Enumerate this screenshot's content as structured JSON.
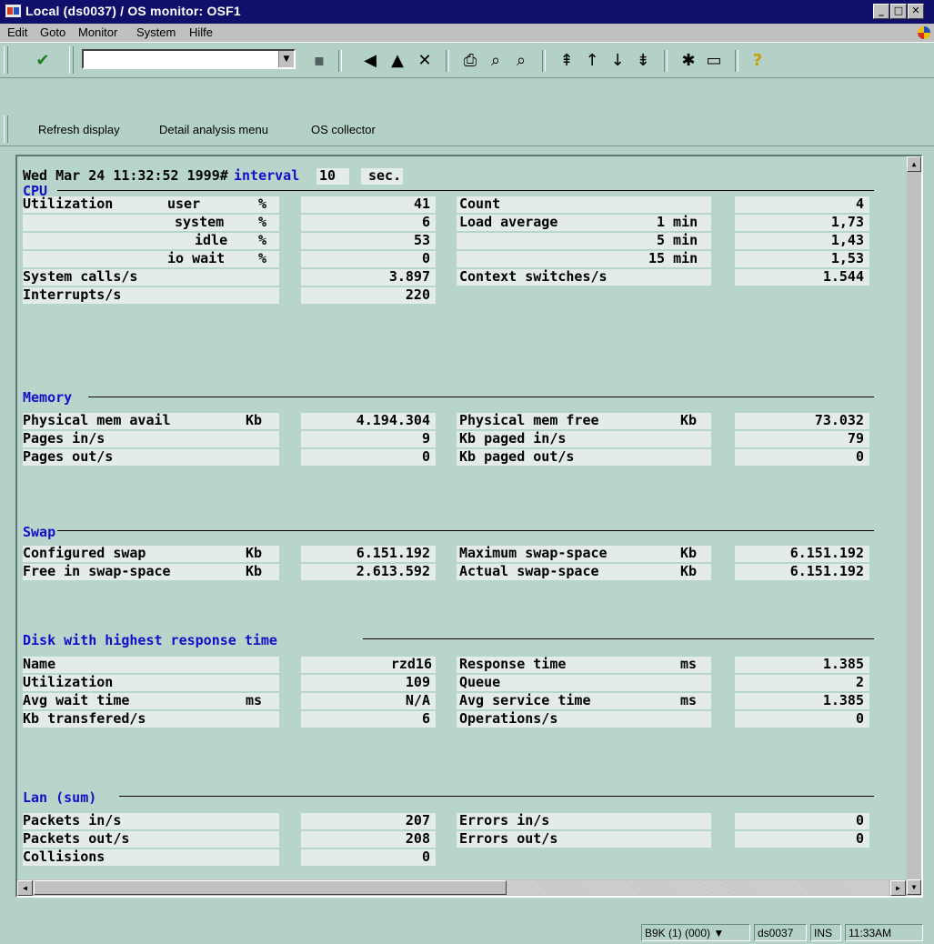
{
  "window": {
    "title": "Local (ds0037)  / OS monitor: OSF1"
  },
  "menu": [
    {
      "label": "Edit"
    },
    {
      "label": "Goto"
    },
    {
      "label": "Monitor"
    },
    {
      "label": "System"
    },
    {
      "label": "Hilfe"
    }
  ],
  "app_toolbar": {
    "refresh": "Refresh display",
    "detail": "Detail analysis menu",
    "collector": "OS collector"
  },
  "header": {
    "timestamp": "Wed Mar 24 11:32:52 1999#",
    "interval_label": "interval",
    "interval_value": "10",
    "unit": "sec."
  },
  "cpu": {
    "title": "CPU",
    "utilization_label": "Utilization",
    "user_label": "user",
    "system_label": "system",
    "idle_label": "idle",
    "iowait_label": "io wait",
    "pct": "%",
    "user": "41",
    "system": "6",
    "idle": "53",
    "iowait": "0",
    "syscalls_label": "System calls/s",
    "syscalls": "3.897",
    "interrupts_label": "Interrupts/s",
    "interrupts": "220",
    "count_label": "Count",
    "count": "4",
    "load_label": "Load average",
    "load1_label": "1 min",
    "load1": "1,73",
    "load5_label": "5 min",
    "load5": "1,43",
    "load15_label": "15 min",
    "load15": "1,53",
    "ctx_label": "Context switches/s",
    "ctx": "1.544"
  },
  "memory": {
    "title": "Memory",
    "avail_label": "Physical mem avail",
    "avail_unit": "Kb",
    "avail": "4.194.304",
    "pagesin_label": "Pages in/s",
    "pagesin": "9",
    "pagesout_label": "Pages out/s",
    "pagesout": "0",
    "free_label": "Physical mem free",
    "free_unit": "Kb",
    "free": "73.032",
    "kbin_label": "Kb paged in/s",
    "kbin": "79",
    "kbout_label": "Kb paged out/s",
    "kbout": "0"
  },
  "swap": {
    "title": "Swap",
    "conf_label": "Configured swap",
    "conf_unit": "Kb",
    "conf": "6.151.192",
    "freein_label": "Free in swap-space",
    "freein_unit": "Kb",
    "freein": "2.613.592",
    "max_label": "Maximum swap-space",
    "max_unit": "Kb",
    "max": "6.151.192",
    "actual_label": "Actual swap-space",
    "actual_unit": "Kb",
    "actual": "6.151.192"
  },
  "disk": {
    "title": "Disk with highest response time",
    "name_label": "Name",
    "name": "rzd16",
    "util_label": "Utilization",
    "util": "109",
    "wait_label": "Avg wait time",
    "wait_unit": "ms",
    "wait": "N/A",
    "kbt_label": "Kb transfered/s",
    "kbt": "6",
    "resp_label": "Response time",
    "resp_unit": "ms",
    "resp": "1.385",
    "queue_label": "Queue",
    "queue": "2",
    "svc_label": "Avg service time",
    "svc_unit": "ms",
    "svc": "1.385",
    "ops_label": "Operations/s",
    "ops": "0"
  },
  "lan": {
    "title": "Lan (sum)",
    "pin_label": "Packets in/s",
    "pin": "207",
    "pout_label": "Packets out/s",
    "pout": "208",
    "coll_label": "Collisions",
    "coll": "0",
    "ein_label": "Errors in/s",
    "ein": "0",
    "eout_label": "Errors out/s",
    "eout": "0"
  },
  "status": {
    "system": "B9K (1) (000)",
    "server": "ds0037",
    "mode": "INS",
    "time": "11:33AM"
  }
}
